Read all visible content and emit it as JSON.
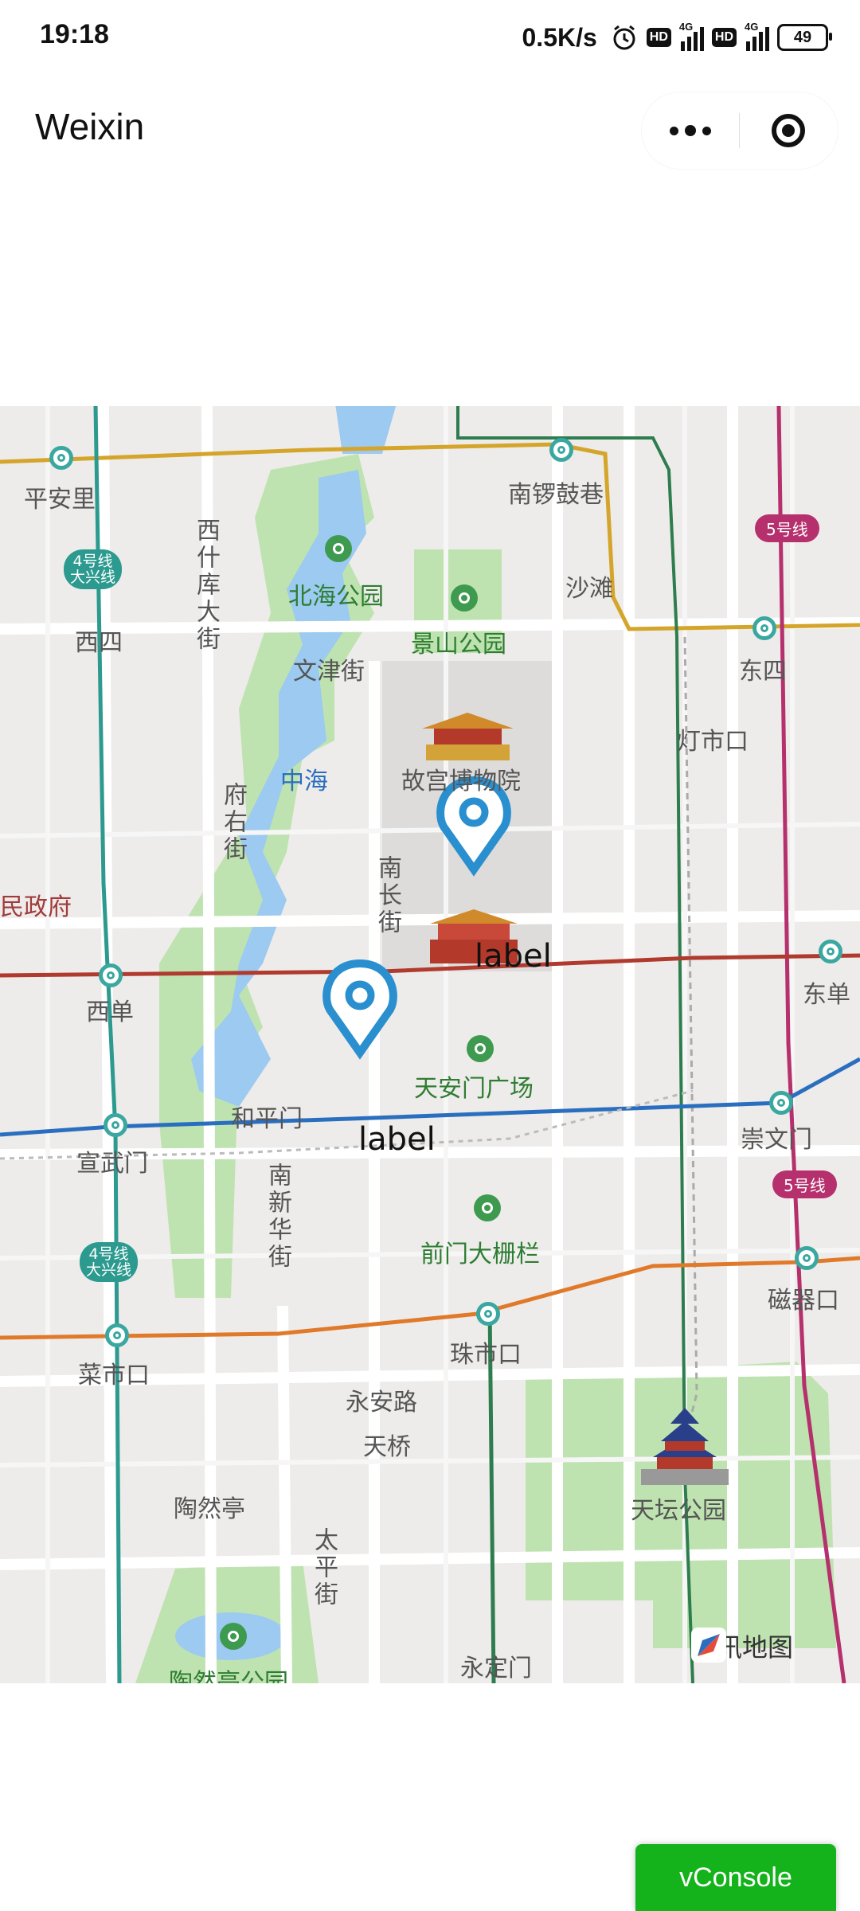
{
  "status_bar": {
    "time": "19:18",
    "speed": "0.5K/s",
    "hd1": "HD",
    "net1": "4G",
    "hd2": "HD",
    "net2": "4G",
    "battery": "49"
  },
  "nav_bar": {
    "title": "Weixin"
  },
  "map": {
    "provider_logo": "腾讯地图",
    "pois": {
      "pinganli": "平安里",
      "nanluoguxiang": "南锣鼓巷",
      "shichahai_top": "南锣鼓巷",
      "xishiku": "西什库大街",
      "beihai": "北海公园",
      "shatan": "沙滩",
      "jingshan": "景山公园",
      "xisi": "西四",
      "dongsi": "东四",
      "wenjinjie": "文津街",
      "dengshikou": "灯市口",
      "zhonghai": "中海",
      "gugong": "故宫博物院",
      "fuyoujie": "府右街",
      "minzhengfu": "民政府",
      "nanchangjie": "南长街",
      "xidan": "西单",
      "dongdan": "东单",
      "tiananmen_sq": "天安门广场",
      "hepingmen": "和平门",
      "xuanwumen": "宣武门",
      "chongwenmen": "崇文门",
      "nanxinhuajie": "南新华街",
      "qianmen": "前门大栅栏",
      "caishikou": "菜市口",
      "zhushikou": "珠市口",
      "ciqikou": "磁器口",
      "yonganlu": "永安路",
      "tianqiao": "天桥",
      "taoranting": "陶然亭",
      "taipingjie": "太平街",
      "tiantan": "天坛公园",
      "taoranting_park": "陶然亭公园",
      "yongdingmen": "永定门"
    },
    "metro_badges": {
      "line4_top": "4号线\n大兴线",
      "line4_bottom": "4号线\n大兴线",
      "line5_top": "5号线",
      "line5_bottom": "5号线"
    },
    "markers": [
      {
        "label": "label"
      },
      {
        "label": "label"
      }
    ],
    "colors": {
      "marker": "#2a8fcf",
      "park": "#bfe3b0",
      "water": "#9ccaf0",
      "palace": "#dddcda",
      "road_main": "#ffffff",
      "line4": "#2c9a8f",
      "line5": "#b5306c",
      "line1": "#b03a2e",
      "line2": "#2a6fbf",
      "line7": "#e07a2a",
      "line6": "#d4a52a",
      "line8": "#2e7d4f"
    }
  },
  "vconsole": {
    "label": "vConsole"
  }
}
